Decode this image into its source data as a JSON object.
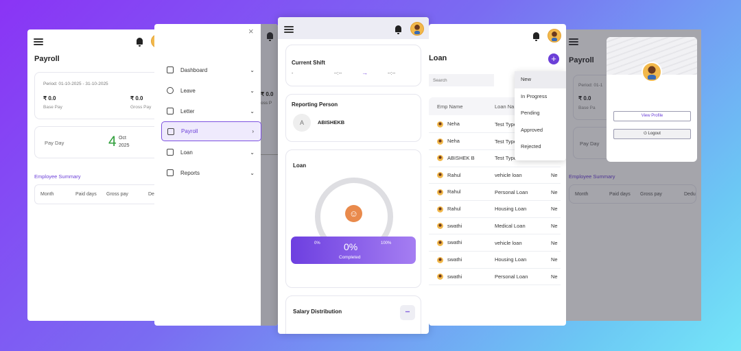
{
  "screen1": {
    "title": "Payroll",
    "period": "Period: 01-10-2025 - 31-10-2025",
    "base_pay_value": "₹ 0.0",
    "base_pay_label": "Base Pay",
    "gross_pay_value": "₹ 0.0",
    "gross_pay_label": "Gross Pay",
    "pay_day_label": "Pay Day",
    "pay_day_number": "4",
    "pay_day_month": "Oct",
    "pay_day_year": "2025",
    "summary_title": "Employee Summary",
    "columns": [
      "Month",
      "Paid days",
      "Gross pay",
      "Dedu"
    ]
  },
  "screen2": {
    "menu": [
      {
        "label": "Dashboard",
        "icon": "grid-icon",
        "chevron": "⌄"
      },
      {
        "label": "Leave",
        "icon": "person-icon",
        "chevron": "⌄"
      },
      {
        "label": "Letter",
        "icon": "clipboard-icon",
        "chevron": "⌄"
      },
      {
        "label": "Payroll",
        "icon": "money-icon",
        "chevron": "›"
      },
      {
        "label": "Loan",
        "icon": "hand-coin-icon",
        "chevron": "⌄"
      },
      {
        "label": "Reports",
        "icon": "report-icon",
        "chevron": "⌄"
      }
    ],
    "close": "×",
    "bg_value": "₹ 0.0",
    "bg_label": "oss P"
  },
  "screen3": {
    "current_shift_title": "Current Shift",
    "shift_start": "-",
    "shift_mid": "--:--",
    "shift_end": "--:--",
    "reporting_title": "Reporting Person",
    "reporting_initial": "A",
    "reporting_name": "ABISHEKB",
    "loan_title": "Loan",
    "loan_left": "0%",
    "loan_right": "100%",
    "loan_percent": "0%",
    "loan_status": "Completed",
    "salary_title": "Salary Distribution",
    "more": "•••",
    "accent": "#7b4fe0"
  },
  "screen4": {
    "title": "Loan",
    "search_placeholder": "Search",
    "columns": [
      "Emp Name",
      "Loan Na",
      "No"
    ],
    "rows": [
      {
        "name": "Neha",
        "loan": "Test Type",
        "no": ""
      },
      {
        "name": "Neha",
        "loan": "Test Type",
        "no": ""
      },
      {
        "name": "ABISHEK B",
        "loan": "Test Type",
        "no": ""
      },
      {
        "name": "Rahul",
        "loan": "vehicle loan",
        "no": "Ne"
      },
      {
        "name": "Rahul",
        "loan": "Personal Loan",
        "no": "Ne"
      },
      {
        "name": "Rahul",
        "loan": "Housing Loan",
        "no": "Ne"
      },
      {
        "name": "swathi",
        "loan": "Medical Loan",
        "no": "Ne"
      },
      {
        "name": "swathi",
        "loan": "vehicle loan",
        "no": "Ne"
      },
      {
        "name": "swathi",
        "loan": "Housing Loan",
        "no": "Ne"
      },
      {
        "name": "swathi",
        "loan": "Personal Loan",
        "no": "Ne"
      }
    ],
    "status_options": [
      "New",
      "In Progress",
      "Pending",
      "Approved",
      "Rejected"
    ],
    "add": "+"
  },
  "screen5": {
    "title": "Payroll",
    "period": "Period: 01-1",
    "base_pay_value": "₹ 0.0",
    "base_pay_label": "Base Pa",
    "pay_day_label": "Pay Day",
    "summary_title": "Employee Summary",
    "columns": [
      "Month",
      "Paid days",
      "Gross pay",
      "Dedu"
    ],
    "view_profile": "View Profile",
    "logout": "⏻ Logout"
  }
}
